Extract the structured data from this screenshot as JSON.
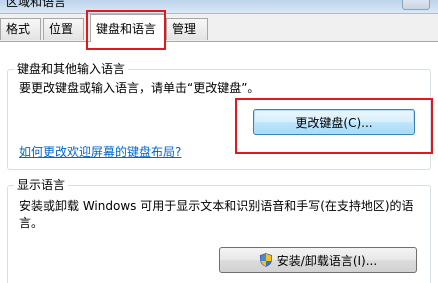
{
  "window": {
    "title": "区域和语言"
  },
  "tabs": [
    {
      "label": "格式"
    },
    {
      "label": "位置"
    },
    {
      "label": "键盘和语言",
      "active": true
    },
    {
      "label": "管理"
    }
  ],
  "keyboards_group": {
    "label": "键盘和其他输入语言",
    "description": "要更改键盘或输入语言，请单击“更改键盘”。",
    "change_keyboard_button": "更改键盘(C)...",
    "welcome_link": "如何更改欢迎屏幕的键盘布局?"
  },
  "display_language_group": {
    "label": "显示语言",
    "description_line1": "安装或卸载 Windows 可用于显示文本和识别语音和手写(在支持地区)的语",
    "description_line2": "言。",
    "install_button": "安装/卸载语言(I)...",
    "install_button_icon": "uac-shield-icon"
  },
  "colors": {
    "highlight": "#e0191c",
    "link": "#0066cc"
  }
}
